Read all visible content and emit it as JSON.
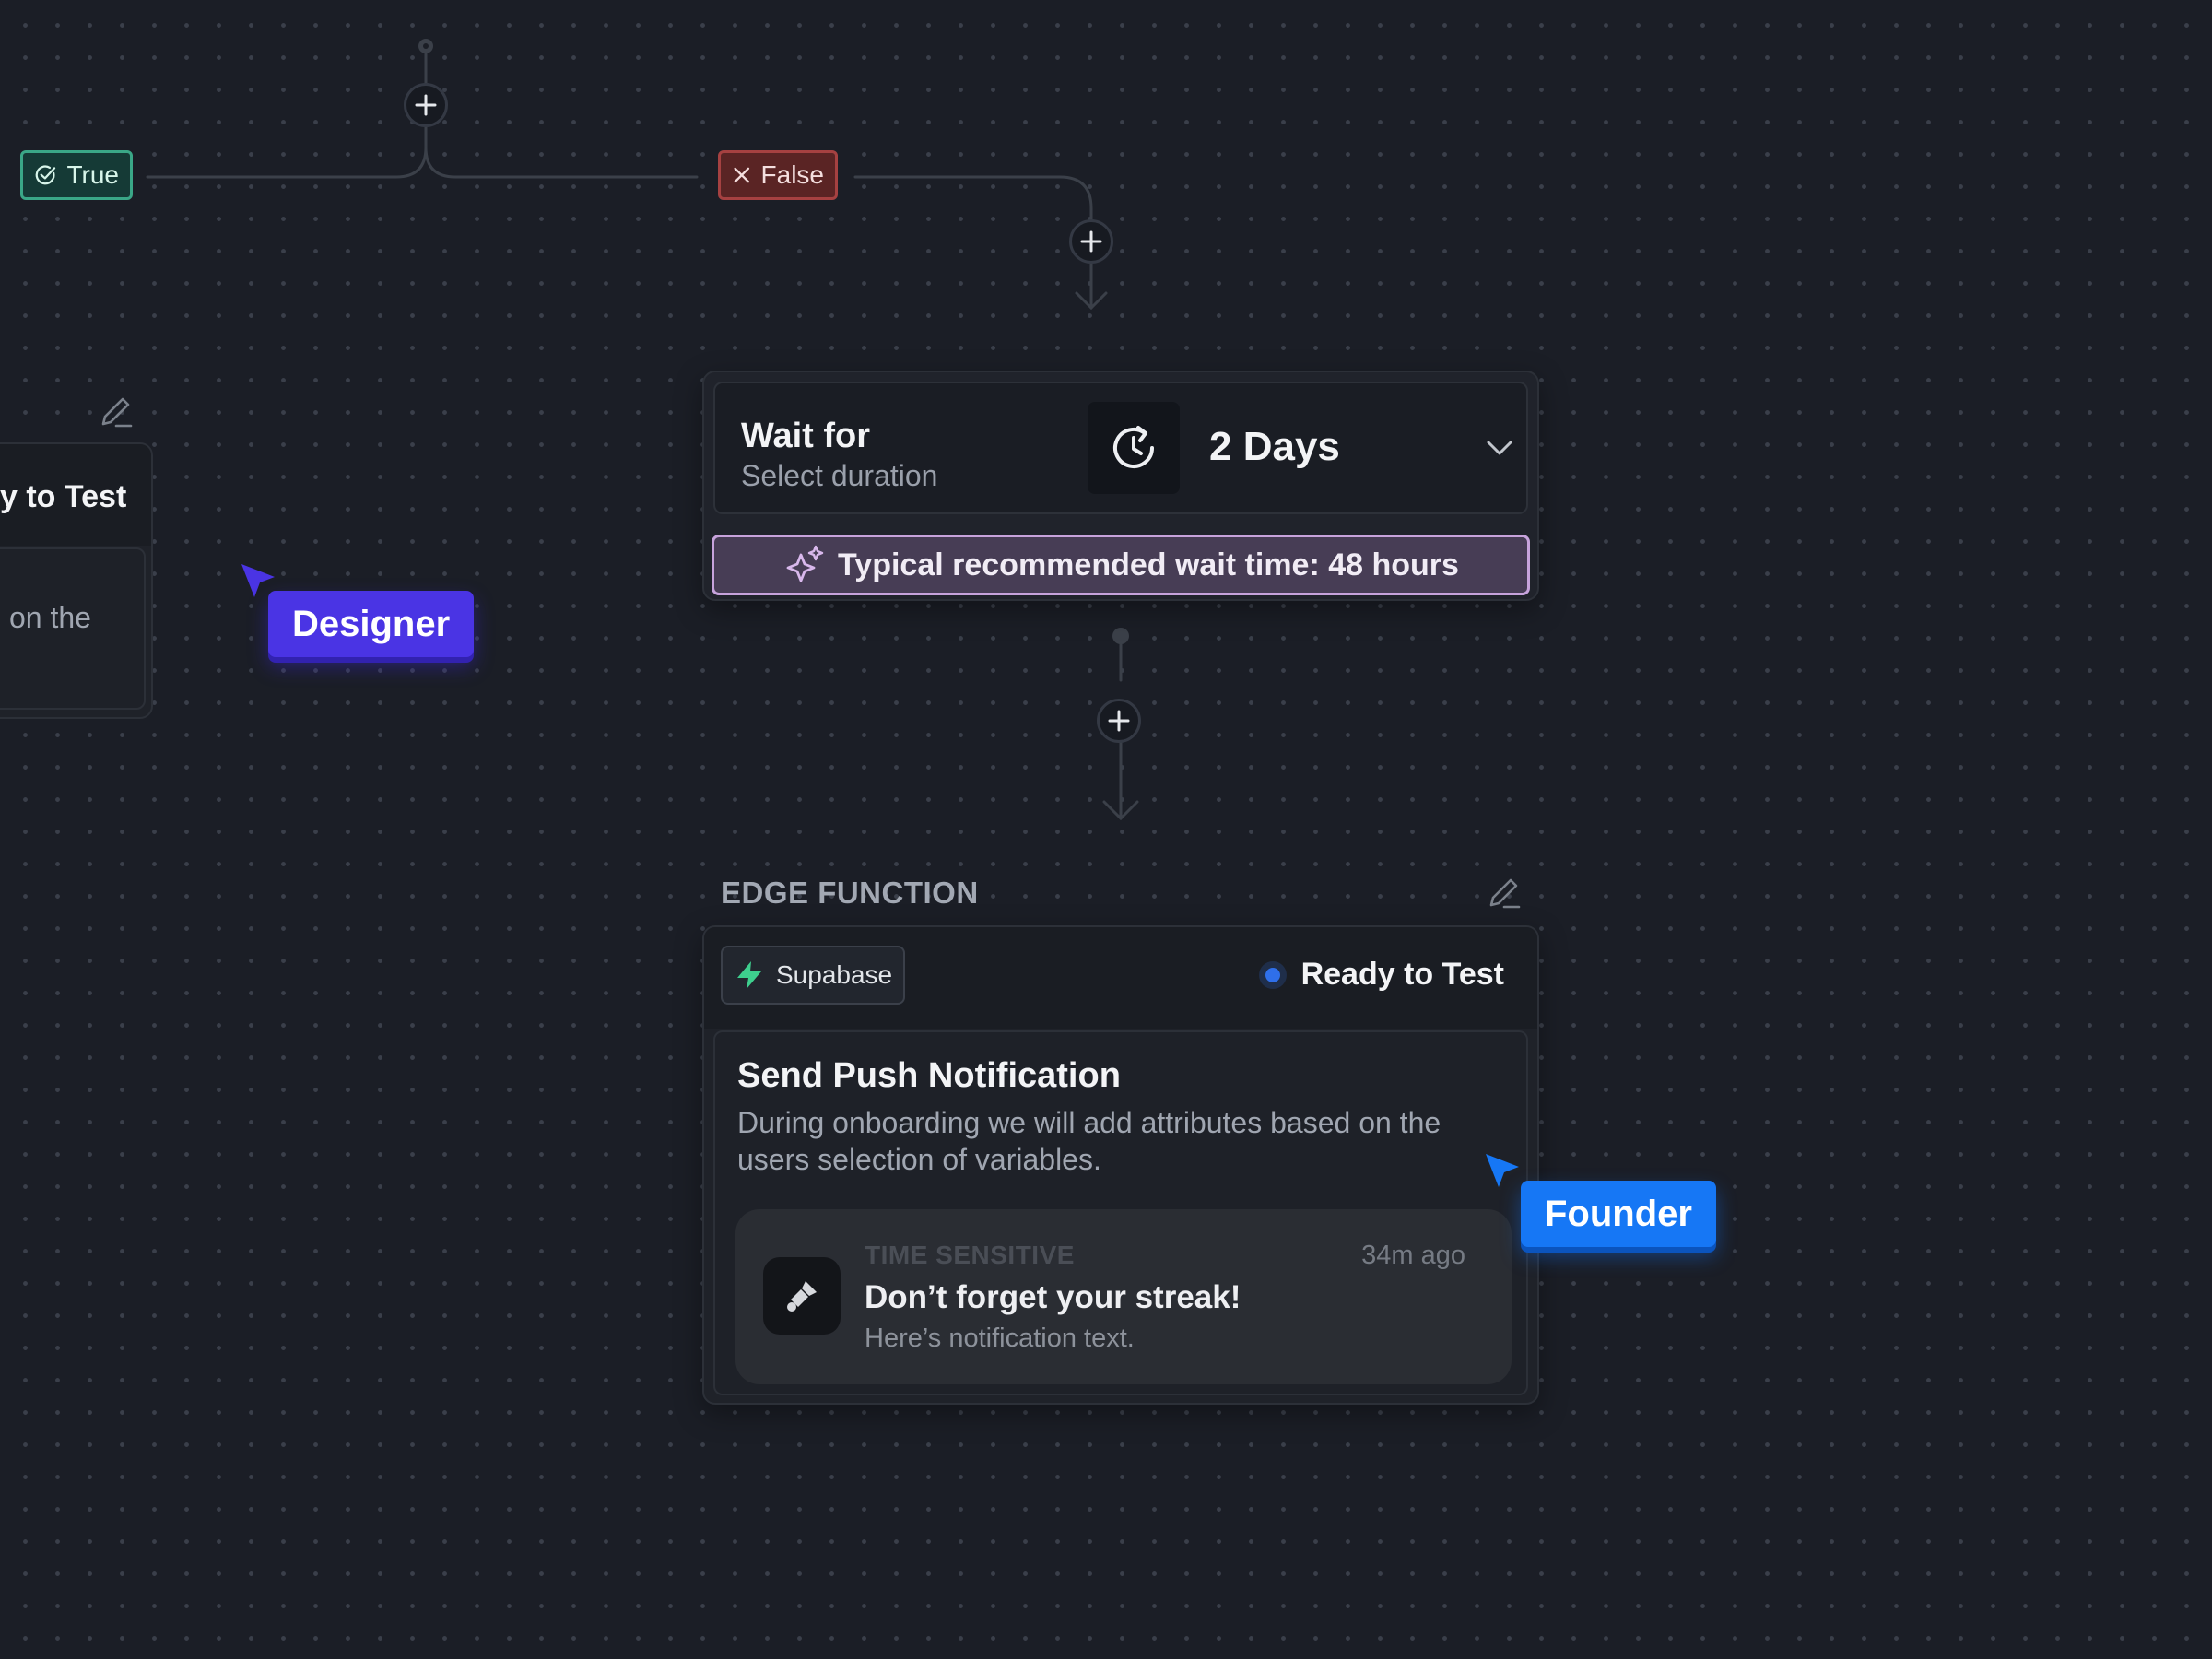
{
  "branches": {
    "true_label": "True",
    "false_label": "False"
  },
  "wait_node": {
    "title": "Wait for",
    "subtitle": "Select duration",
    "duration_value": "2 Days",
    "recommendation": "Typical recommended wait time: 48 hours"
  },
  "edge_function": {
    "section_label": "EDGE FUNCTION",
    "provider": "Supabase",
    "status": "Ready to Test",
    "title": "Send Push Notification",
    "description": "During onboarding we will add attributes based on the users selection of variables.",
    "notification": {
      "category": "TIME SENSITIVE",
      "time": "34m ago",
      "title": "Don’t forget your streak!",
      "text": "Here’s notification text."
    }
  },
  "left_card": {
    "status_fragment": "y to Test",
    "desc_fragment": "on the"
  },
  "collaborators": {
    "designer": "Designer",
    "founder": "Founder"
  },
  "colors": {
    "canvas": "#1b1e26",
    "true_accent": "#3aa787",
    "false_accent": "#a54141",
    "recommend_border": "#c7a3dc",
    "status_dot": "#2f6fe9",
    "supabase_green": "#3ecf8e",
    "designer": "#4a34e4",
    "founder": "#1677f5"
  },
  "icons": [
    "check-circle-icon",
    "close-icon",
    "plus-icon",
    "pencil-icon",
    "clock-icon",
    "chevron-down-icon",
    "sparkle-icon",
    "supabase-bolt-icon",
    "app-brush-icon",
    "cursor-arrow-icon"
  ]
}
